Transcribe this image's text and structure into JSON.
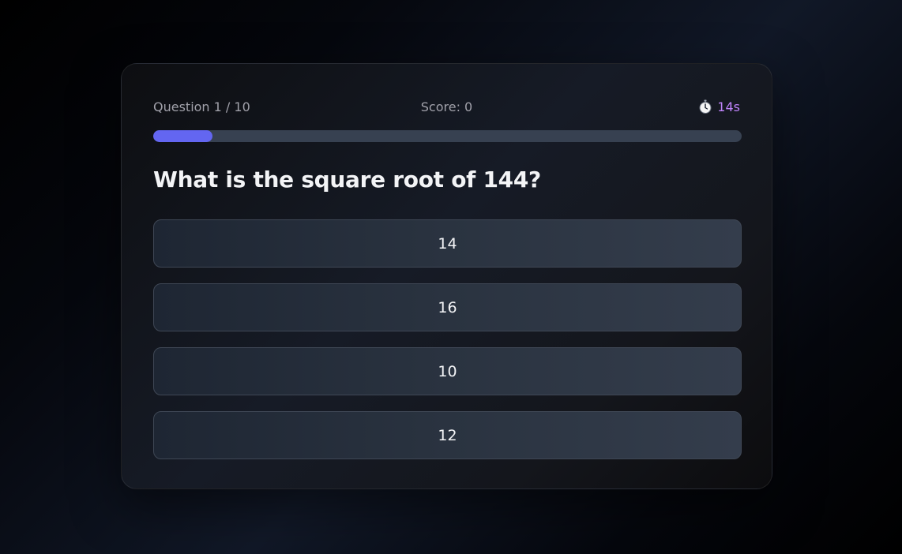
{
  "quiz": {
    "question_counter": "Question 1 / 10",
    "score_label": "Score: 0",
    "timer_label": "14s",
    "timer_icon": "stopwatch-icon",
    "progress_fraction": 0.1,
    "question_text": "What is the square root of 144?",
    "options": [
      "14",
      "16",
      "10",
      "12"
    ]
  },
  "colors": {
    "accent": "#6366f1",
    "timer": "#c084fc",
    "progress_track": "#374151"
  }
}
